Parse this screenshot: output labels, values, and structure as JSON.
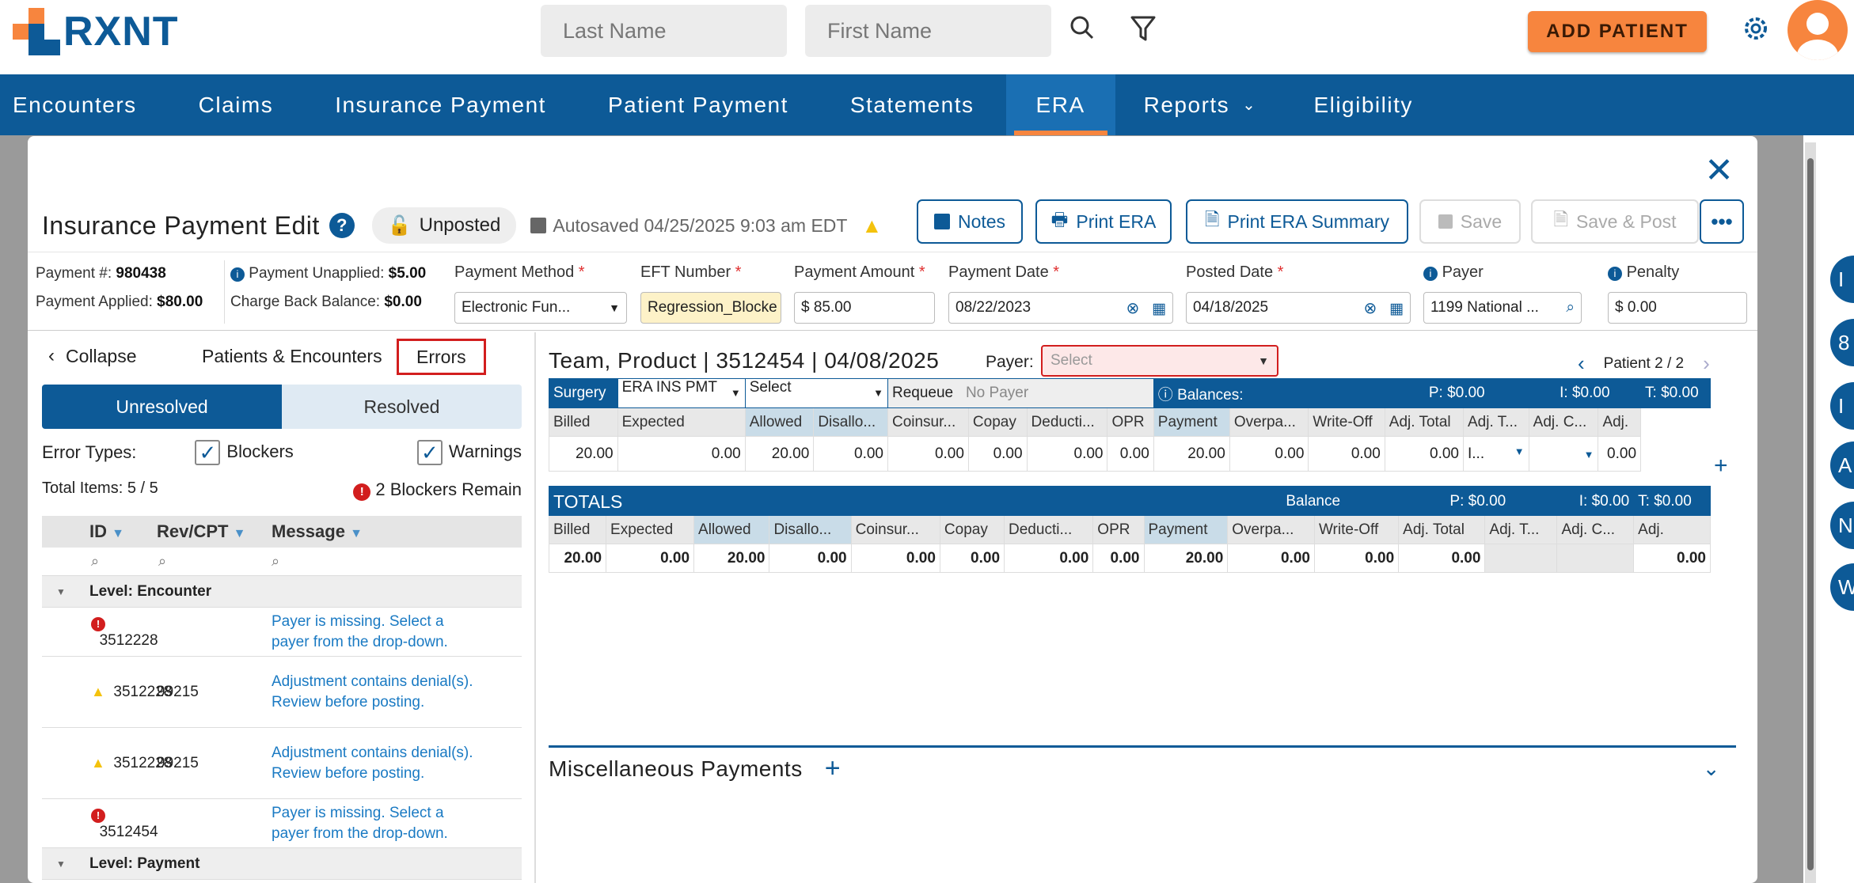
{
  "app": {
    "logo": "RXNT",
    "search_last": "Last Name",
    "search_first": "First Name",
    "add_patient": "ADD PATIENT"
  },
  "nav": [
    "Encounters",
    "Claims",
    "Insurance Payment",
    "Patient Payment",
    "Statements",
    "ERA",
    "Reports",
    "Eligibility"
  ],
  "modal": {
    "title": "Insurance Payment Edit",
    "status": "Unposted",
    "autosaved": "Autosaved 04/25/2025 9:03 am EDT",
    "buttons": {
      "notes": "Notes",
      "print_era": "Print ERA",
      "print_summary": "Print ERA Summary",
      "save": "Save",
      "save_post": "Save & Post"
    }
  },
  "fields": {
    "payment_no_label": "Payment #:",
    "payment_no": "980438",
    "applied_label": "Payment Applied:",
    "applied": "$80.00",
    "unapplied_label": "Payment Unapplied:",
    "unapplied": "$5.00",
    "chargeback_label": "Charge Back Balance:",
    "chargeback": "$0.00",
    "method_label": "Payment Method",
    "method": "Electronic Fun...",
    "eft_label": "EFT Number",
    "eft": "Regression_Blocke",
    "amount_label": "Payment Amount",
    "amount": "$ 85.00",
    "pdate_label": "Payment Date",
    "pdate": "08/22/2023",
    "posted_label": "Posted Date",
    "posted": "04/18/2025",
    "payer_label": "Payer",
    "payer": "1199 National ...",
    "penalty_label": "Penalty",
    "penalty": "$ 0.00"
  },
  "left": {
    "collapse": "Collapse",
    "tab_pe": "Patients & Encounters",
    "tab_errors": "Errors",
    "unresolved": "Unresolved",
    "resolved": "Resolved",
    "error_types": "Error Types:",
    "blockers": "Blockers",
    "warnings": "Warnings",
    "total": "Total Items: 5 / 5",
    "blockers_remain": "2 Blockers Remain",
    "cols": [
      "ID",
      "Rev/CPT",
      "Message"
    ],
    "level_enc": "Level: Encounter",
    "level_pay": "Level: Payment",
    "rows": [
      {
        "type": "error",
        "id": "3512228",
        "cpt": "",
        "msg": "Payer is missing. Select a payer from the drop-down."
      },
      {
        "type": "warn",
        "id": "3512228",
        "cpt": "99215",
        "msg": "Adjustment contains denial(s). Review before posting."
      },
      {
        "type": "warn",
        "id": "3512228",
        "cpt": "99215",
        "msg": "Adjustment contains denial(s). Review before posting."
      },
      {
        "type": "error",
        "id": "3512454",
        "cpt": "",
        "msg": "Payer is missing. Select a payer from the drop-down."
      }
    ]
  },
  "right": {
    "header": "Team, Product | 3512454 | 04/08/2025",
    "payer_label": "Payer:",
    "payer_ph": "Select",
    "pager": "Patient 2 / 2",
    "surgery": "Surgery",
    "era_ins": "ERA INS PMT",
    "select": "Select",
    "requeue": "Requeue",
    "no_payer": "No Payer",
    "balances": "Balances:",
    "p": "P: $0.00",
    "i": "I: $0.00",
    "t": "T: $0.00",
    "cols": [
      "Billed",
      "Expected",
      "Allowed",
      "Disallo...",
      "Coinsur...",
      "Copay",
      "Deducti...",
      "OPR",
      "Payment",
      "Overpa...",
      "Write-Off",
      "Adj. Total",
      "Adj. T...",
      "Adj. C...",
      "Adj."
    ],
    "line": [
      "20.00",
      "0.00",
      "20.00",
      "0.00",
      "0.00",
      "0.00",
      "0.00",
      "0.00",
      "20.00",
      "0.00",
      "0.00",
      "0.00",
      "I...",
      "",
      "0.00"
    ],
    "totals": "TOTALS",
    "balance": "Balance",
    "tot": [
      "20.00",
      "0.00",
      "20.00",
      "0.00",
      "0.00",
      "0.00",
      "0.00",
      "0.00",
      "20.00",
      "0.00",
      "0.00",
      "0.00",
      "",
      "",
      "0.00"
    ],
    "misc": "Miscellaneous Payments"
  },
  "colors": {
    "brand": "#0d5a97",
    "accent": "#f7853e",
    "error": "#d21e1e",
    "warn": "#f4c20d"
  }
}
